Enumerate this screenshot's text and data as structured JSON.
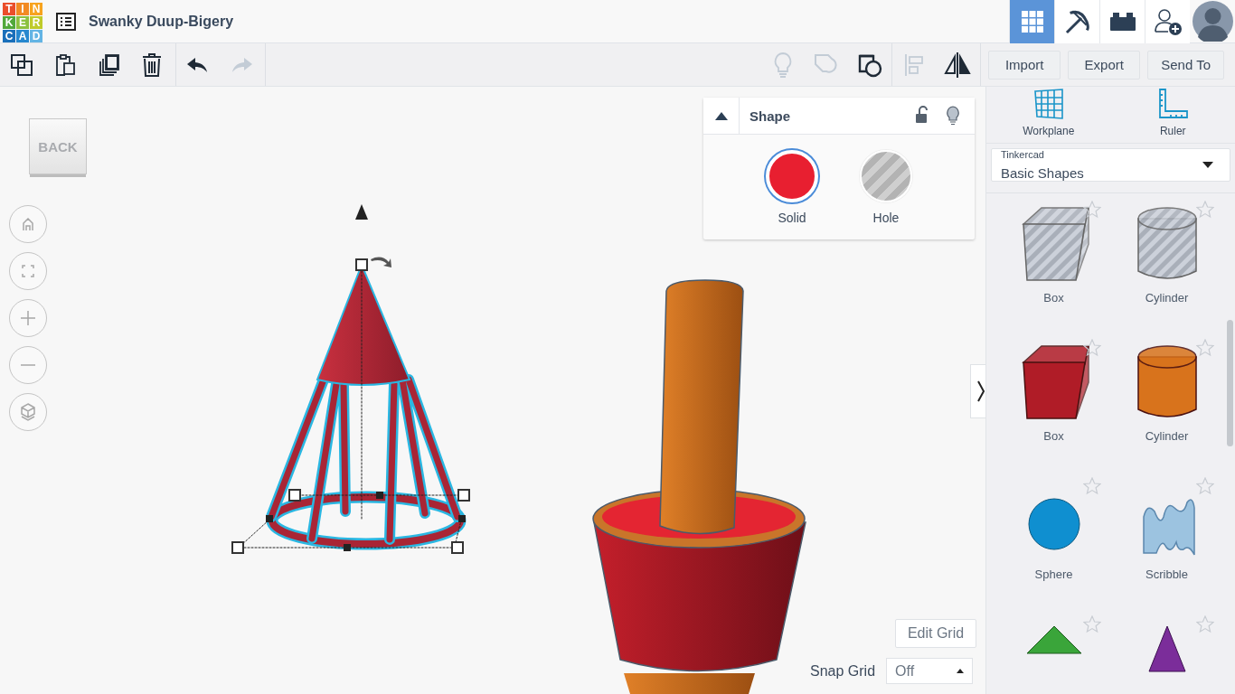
{
  "header": {
    "logo": [
      {
        "letter": "T",
        "color": "#ea4e2b"
      },
      {
        "letter": "I",
        "color": "#f28a22"
      },
      {
        "letter": "N",
        "color": "#f7a31e"
      },
      {
        "letter": "K",
        "color": "#51a83a"
      },
      {
        "letter": "E",
        "color": "#8cc13f"
      },
      {
        "letter": "R",
        "color": "#bfcb2a"
      },
      {
        "letter": "C",
        "color": "#1a6fba"
      },
      {
        "letter": "A",
        "color": "#2788cf"
      },
      {
        "letter": "D",
        "color": "#63b4e4"
      }
    ],
    "project_title": "Swanky Duup-Bigery",
    "view_modes": [
      {
        "kind": "grid",
        "selected": true
      },
      {
        "kind": "pickaxe",
        "selected": false
      },
      {
        "kind": "bricks",
        "selected": false
      }
    ]
  },
  "toolbar": {
    "edit_tools": [
      {
        "kind": "copy",
        "disabled": false
      },
      {
        "kind": "paste",
        "disabled": false
      },
      {
        "kind": "duplicate",
        "disabled": false
      },
      {
        "kind": "delete",
        "disabled": false
      }
    ],
    "history_tools": [
      {
        "kind": "undo",
        "disabled": false
      },
      {
        "kind": "redo",
        "disabled": true
      }
    ],
    "shape_tools": [
      {
        "kind": "light",
        "disabled": true
      },
      {
        "kind": "group",
        "disabled": true
      },
      {
        "kind": "ungroup",
        "disabled": false
      },
      {
        "kind": "align",
        "disabled": true
      },
      {
        "kind": "mirror",
        "disabled": false
      }
    ],
    "buttons": [
      "Import",
      "Export",
      "Send To"
    ]
  },
  "view_cube": {
    "face": "BACK"
  },
  "shape_panel": {
    "title": "Shape",
    "options": [
      {
        "label": "Solid",
        "kind": "solid",
        "selected": true
      },
      {
        "label": "Hole",
        "kind": "hole",
        "selected": false
      }
    ]
  },
  "helpers": [
    {
      "label": "Workplane",
      "kind": "workplane"
    },
    {
      "label": "Ruler",
      "kind": "ruler"
    }
  ],
  "library": {
    "source": "Tinkercad",
    "category": "Basic Shapes"
  },
  "shapes": [
    {
      "label": "Box",
      "kind": "box",
      "hole": true
    },
    {
      "label": "Cylinder",
      "kind": "cylinder",
      "hole": true
    },
    {
      "label": "Box",
      "kind": "box",
      "hole": false,
      "color": "#b01c27"
    },
    {
      "label": "Cylinder",
      "kind": "cylinder",
      "hole": false,
      "color": "#d8731c"
    },
    {
      "label": "Sphere",
      "kind": "sphere",
      "hole": false,
      "color": "#0f8fd0"
    },
    {
      "label": "Scribble",
      "kind": "scribble",
      "hole": false,
      "color": "#9cc3e0"
    },
    {
      "kind": "roof",
      "hole": false,
      "color": "#3aa53a"
    },
    {
      "kind": "cone",
      "hole": false,
      "color": "#7b2d9a"
    }
  ],
  "grid": {
    "edit_button": "Edit Grid",
    "snap_label": "Snap Grid",
    "snap_value": "Off"
  }
}
